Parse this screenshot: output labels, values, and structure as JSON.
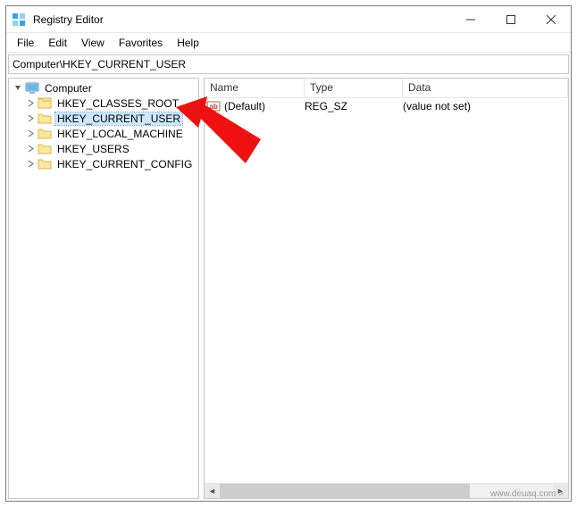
{
  "window": {
    "title": "Registry Editor"
  },
  "menubar": {
    "items": [
      "File",
      "Edit",
      "View",
      "Favorites",
      "Help"
    ]
  },
  "address_bar": {
    "path": "Computer\\HKEY_CURRENT_USER"
  },
  "tree": {
    "root": {
      "label": "Computer",
      "expanded": true
    },
    "children": [
      {
        "label": "HKEY_CLASSES_ROOT",
        "selected": false
      },
      {
        "label": "HKEY_CURRENT_USER",
        "selected": true
      },
      {
        "label": "HKEY_LOCAL_MACHINE",
        "selected": false
      },
      {
        "label": "HKEY_USERS",
        "selected": false
      },
      {
        "label": "HKEY_CURRENT_CONFIG",
        "selected": false
      }
    ]
  },
  "list": {
    "columns": {
      "name": "Name",
      "type": "Type",
      "data": "Data"
    },
    "rows": [
      {
        "name": "(Default)",
        "type": "REG_SZ",
        "data": "(value not set)"
      }
    ]
  },
  "watermark": "www.deuaq.com >"
}
